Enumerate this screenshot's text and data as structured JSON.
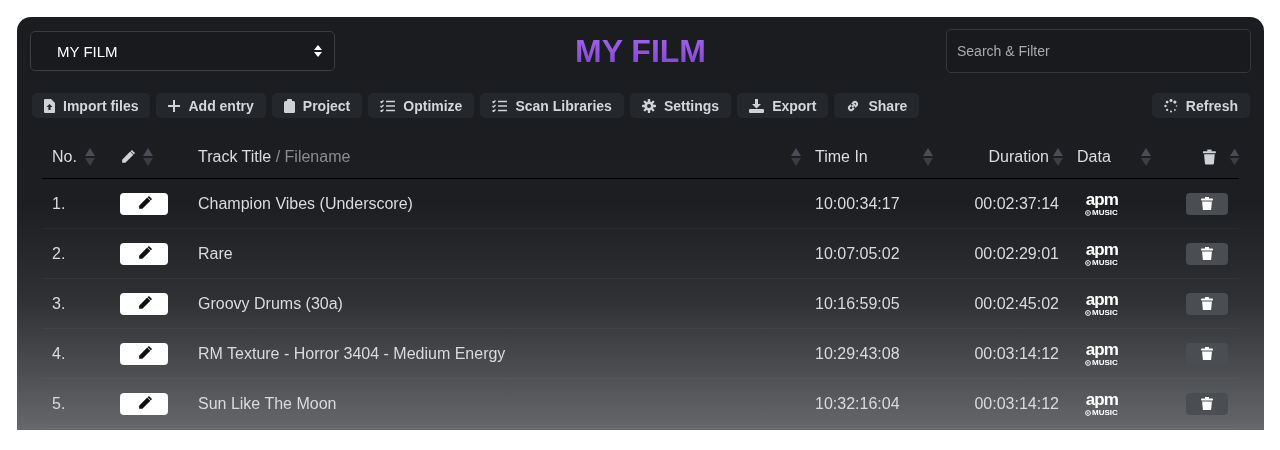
{
  "project_select": {
    "value": "MY FILM"
  },
  "title": "MY FILM",
  "search": {
    "placeholder": "Search & Filter"
  },
  "toolbar": [
    {
      "kind": "import",
      "label": "Import files"
    },
    {
      "kind": "add",
      "label": "Add entry"
    },
    {
      "kind": "project",
      "label": "Project"
    },
    {
      "kind": "checklist",
      "label": "Optimize"
    },
    {
      "kind": "checklist",
      "label": "Scan Libraries"
    },
    {
      "kind": "settings",
      "label": "Settings"
    },
    {
      "kind": "export",
      "label": "Export"
    },
    {
      "kind": "share",
      "label": "Share"
    }
  ],
  "refresh": {
    "label": "Refresh"
  },
  "table": {
    "columns": [
      {
        "kind": "text",
        "label": "No."
      },
      {
        "kind": "edit"
      },
      {
        "kind": "title",
        "label": "Track Title",
        "sublabel": "/ Filename"
      },
      {
        "kind": "text",
        "label": "Time In"
      },
      {
        "kind": "text",
        "label": "Duration"
      },
      {
        "kind": "text",
        "label": "Data"
      },
      {
        "kind": "delete"
      }
    ],
    "rows": [
      {
        "no": "1.",
        "title": "Champion Vibes (Underscore)",
        "time_in": "10:00:34:17",
        "duration": "00:02:37:14",
        "logo": "apm",
        "logo_sub": "MUSIC"
      },
      {
        "no": "2.",
        "title": "Rare",
        "time_in": "10:07:05:02",
        "duration": "00:02:29:01",
        "logo": "apm",
        "logo_sub": "MUSIC"
      },
      {
        "no": "3.",
        "title": "Groovy Drums (30a)",
        "time_in": "10:16:59:05",
        "duration": "00:02:45:02",
        "logo": "apm",
        "logo_sub": "MUSIC"
      },
      {
        "no": "4.",
        "title": "RM Texture - Horror 3404 - Medium Energy",
        "time_in": "10:29:43:08",
        "duration": "00:03:14:12",
        "logo": "apm",
        "logo_sub": "MUSIC"
      },
      {
        "no": "5.",
        "title": "Sun Like The Moon",
        "time_in": "10:32:16:04",
        "duration": "00:03:14:12",
        "logo": "apm",
        "logo_sub": "MUSIC"
      }
    ]
  }
}
